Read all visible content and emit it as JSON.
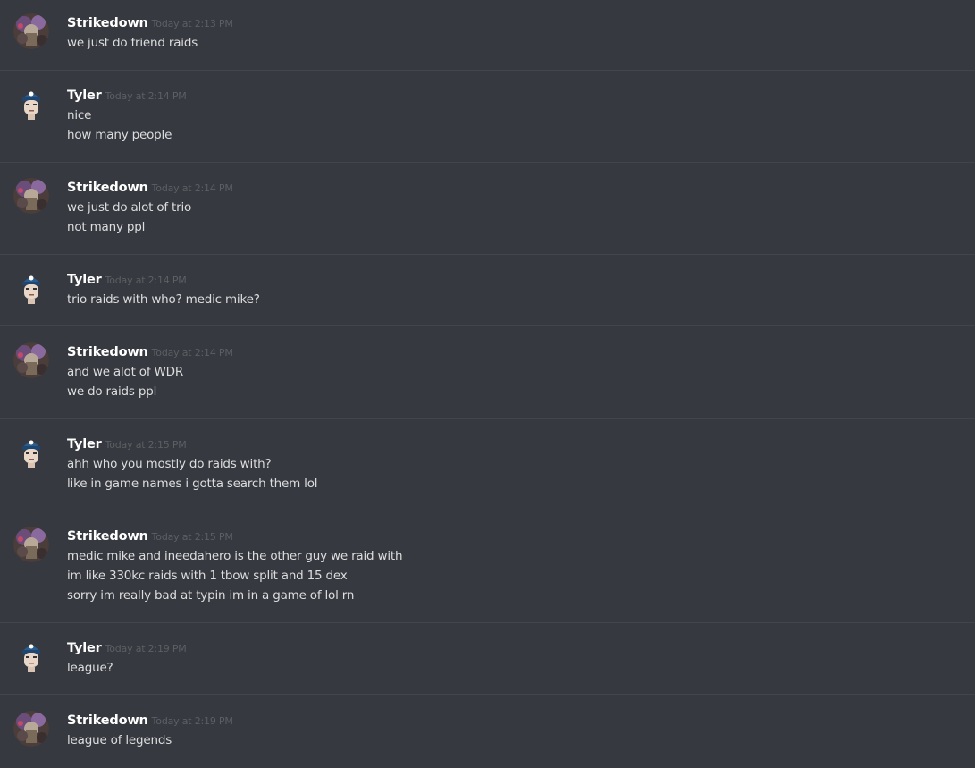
{
  "messages": [
    {
      "user": "Strikedown",
      "avatar": "strikedown-avatar",
      "time": "Today at 2:13 PM",
      "lines": [
        "we just do friend raids"
      ]
    },
    {
      "user": "Tyler",
      "avatar": "tyler-avatar",
      "time": "Today at 2:14 PM",
      "lines": [
        "nice",
        "how many people"
      ]
    },
    {
      "user": "Strikedown",
      "avatar": "strikedown-avatar",
      "time": "Today at 2:14 PM",
      "lines": [
        "we just do alot of trio",
        "not many ppl"
      ]
    },
    {
      "user": "Tyler",
      "avatar": "tyler-avatar",
      "time": "Today at 2:14 PM",
      "lines": [
        "trio raids with who? medic mike?"
      ]
    },
    {
      "user": "Strikedown",
      "avatar": "strikedown-avatar",
      "time": "Today at 2:14 PM",
      "lines": [
        "and we alot of WDR",
        "we do raids ppl"
      ]
    },
    {
      "user": "Tyler",
      "avatar": "tyler-avatar",
      "time": "Today at 2:15 PM",
      "lines": [
        "ahh who you mostly do raids with?",
        "like in game names i gotta search them lol"
      ]
    },
    {
      "user": "Strikedown",
      "avatar": "strikedown-avatar",
      "time": "Today at 2:15 PM",
      "lines": [
        "medic mike and ineedahero is the other guy we raid with",
        "im like 330kc raids with 1 tbow split and 15 dex",
        "sorry im really bad at typin im in a game of lol rn"
      ]
    },
    {
      "user": "Tyler",
      "avatar": "tyler-avatar",
      "time": "Today at 2:19 PM",
      "lines": [
        "league?"
      ]
    },
    {
      "user": "Strikedown",
      "avatar": "strikedown-avatar",
      "time": "Today at 2:19 PM",
      "lines": [
        "league of legends"
      ]
    }
  ],
  "colors": {
    "background": "#36393f",
    "divider": "#42454a",
    "username": "#ffffff",
    "timestamp": "#5c5f64",
    "text": "#dcddde"
  }
}
